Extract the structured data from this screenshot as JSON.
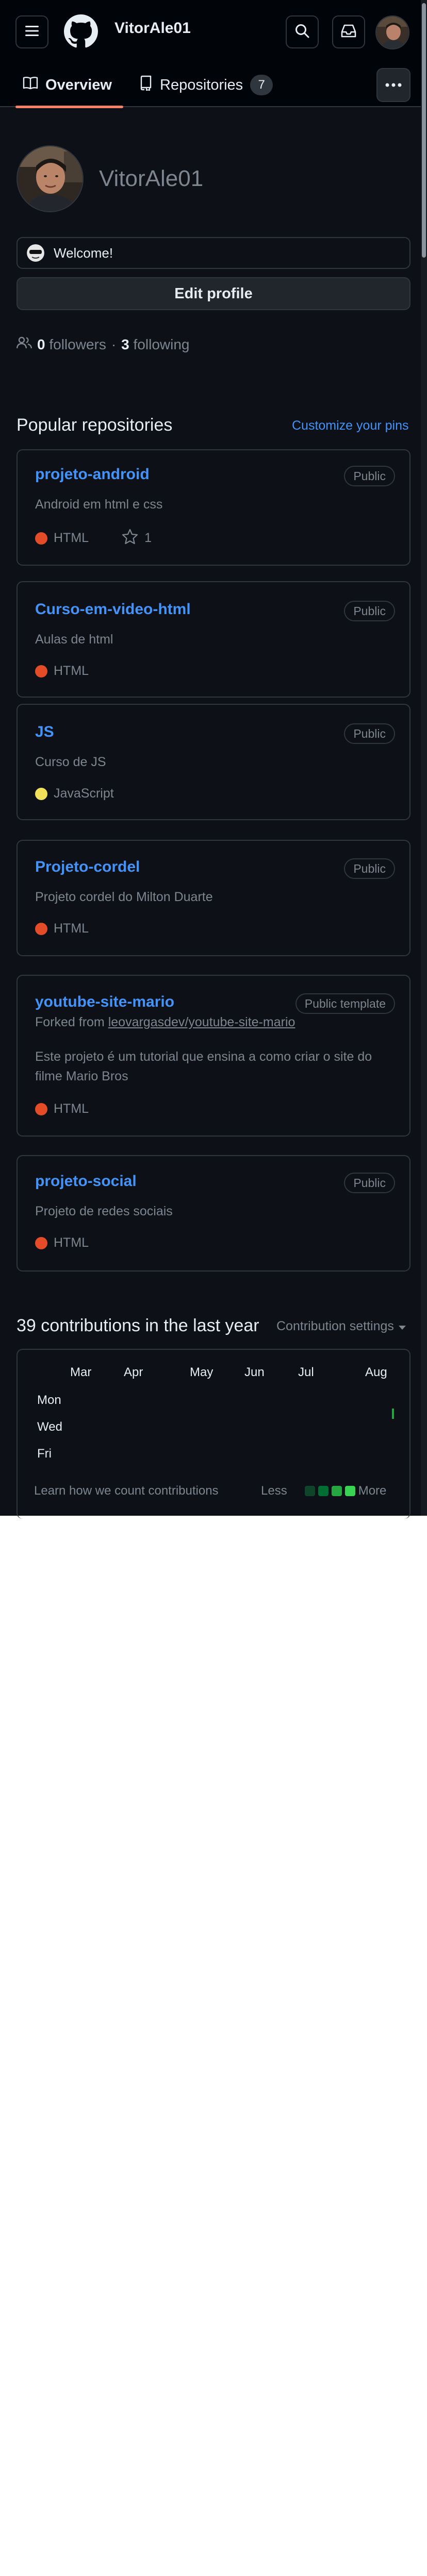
{
  "header": {
    "owner": "VitorAle01",
    "menu_icon": "hamburger-icon",
    "logo_icon": "github-octocat-icon",
    "search_icon": "search-icon",
    "inbox_icon": "inbox-icon"
  },
  "tabs": {
    "overview": "Overview",
    "repositories": "Repositories",
    "repositories_count": "7"
  },
  "profile": {
    "username": "VitorAle01",
    "status": "Welcome!",
    "edit_button": "Edit profile",
    "followers_count": "0",
    "followers_label": "followers",
    "separator": "·",
    "following_count": "3",
    "following_label": "following"
  },
  "popular": {
    "title": "Popular repositories",
    "customize": "Customize your pins",
    "repos": [
      {
        "name": "projeto-android",
        "visibility": "Public",
        "description": "Android em html e css",
        "language": "HTML",
        "stars": "1"
      },
      {
        "name": "Curso-em-video-html",
        "visibility": "Public",
        "description": "Aulas de html",
        "language": "HTML"
      },
      {
        "name": "JS",
        "visibility": "Public",
        "description": "Curso de JS",
        "language": "JavaScript"
      },
      {
        "name": "Projeto-cordel",
        "visibility": "Public",
        "description": "Projeto cordel do Milton Duarte",
        "language": "HTML"
      },
      {
        "name": "youtube-site-mario",
        "visibility": "Public template",
        "forked_prefix": "Forked from",
        "forked_from": "leovargasdev/youtube-site-mario",
        "description": "Este projeto é um tutorial que ensina a como criar o site do filme Mario Bros",
        "language": "HTML"
      },
      {
        "name": "projeto-social",
        "visibility": "Public",
        "description": "Projeto de redes sociais",
        "language": "HTML"
      }
    ]
  },
  "contributions": {
    "title": "39 contributions in the last year",
    "settings": "Contribution settings",
    "months": [
      "Mar",
      "Apr",
      "May",
      "Jun",
      "Jul",
      "Aug"
    ],
    "days": [
      "Mon",
      "Wed",
      "Fri"
    ],
    "learn": "Learn how we count contributions",
    "less": "Less",
    "more": "More"
  },
  "colors": {
    "bg": "#0d1117",
    "header_bg": "#010409",
    "link": "#4493f8",
    "html": "#e34c26",
    "javascript": "#f1e05a",
    "tab_underline": "#f78166"
  }
}
